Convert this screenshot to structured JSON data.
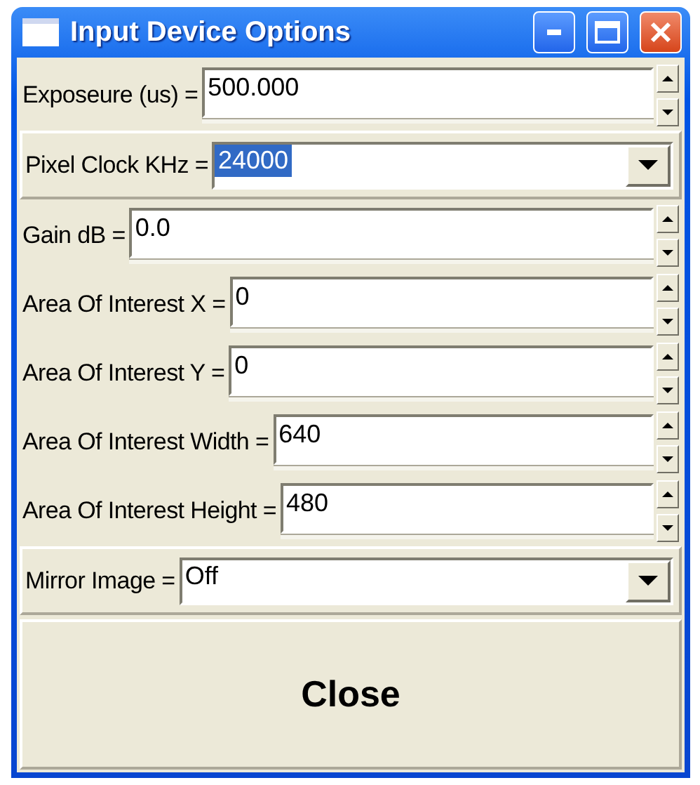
{
  "window": {
    "title": "Input Device Options"
  },
  "fields": [
    {
      "kind": "spin",
      "label": "Exposeure (us) =",
      "value": "500.000"
    },
    {
      "kind": "combo",
      "label": "Pixel Clock KHz =",
      "value": "24000",
      "highlighted": true
    },
    {
      "kind": "spin",
      "label": "Gain dB =",
      "value": "0.0"
    },
    {
      "kind": "spin",
      "label": "Area Of Interest X =",
      "value": "0"
    },
    {
      "kind": "spin",
      "label": "Area Of Interest Y =",
      "value": "0"
    },
    {
      "kind": "spin",
      "label": "Area Of Interest Width =",
      "value": "640"
    },
    {
      "kind": "spin",
      "label": "Area Of Interest Height =",
      "value": "480"
    },
    {
      "kind": "combo",
      "label": "Mirror Image =",
      "value": "Off",
      "highlighted": false
    }
  ],
  "close_button": "Close"
}
